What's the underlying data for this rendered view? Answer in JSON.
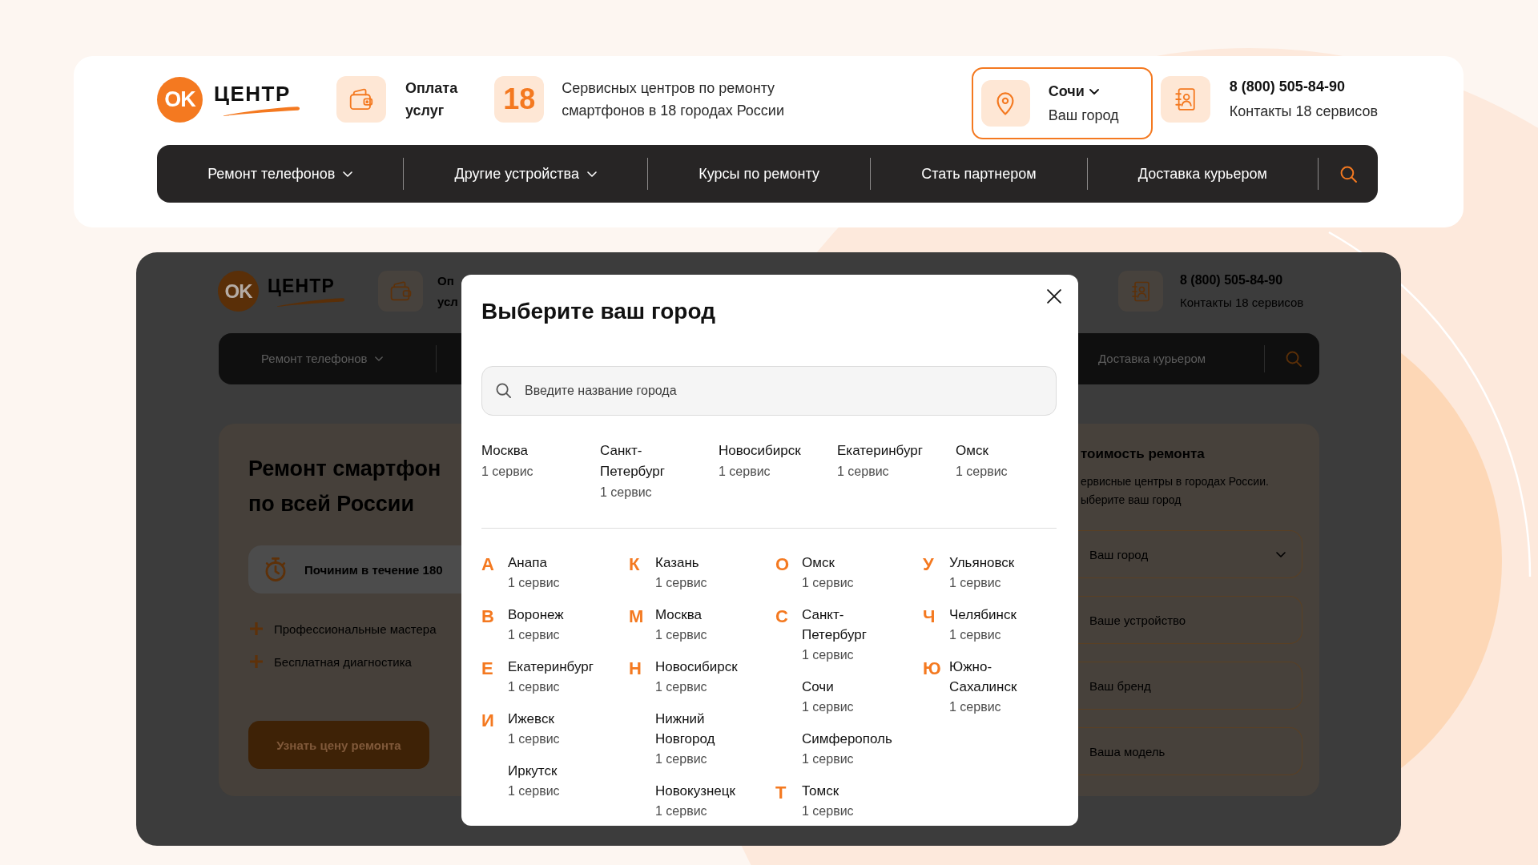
{
  "header": {
    "logo": {
      "mark": "OK",
      "wordmark": "ЦЕНТР"
    },
    "payment_label": "Оплата услуг",
    "city_count": "18",
    "city_count_text": "Сервисных центров по ремонту смартфонов в 18 городах России",
    "city_selector": {
      "value": "Сочи",
      "caption": "Ваш город"
    },
    "contacts": {
      "phone": "8 (800) 505-84-90",
      "caption": "Контакты 18 сервисов"
    }
  },
  "nav": {
    "items": [
      {
        "label": "Ремонт телефонов",
        "kind": "dropdown"
      },
      {
        "label": "Другие устройства",
        "kind": "dropdown"
      },
      {
        "label": "Курсы по ремонту",
        "kind": "link"
      },
      {
        "label": "Стать партнером",
        "kind": "link"
      },
      {
        "label": "Доставка курьером",
        "kind": "link"
      }
    ]
  },
  "preview": {
    "header": {
      "logo": {
        "mark": "OK",
        "wordmark": "ЦЕНТР"
      },
      "payment_label": "Оп усл",
      "contacts": {
        "phone": "8 (800) 505-84-90",
        "caption": "Контакты 18 сервисов"
      }
    },
    "nav_left": [
      {
        "label": "Ремонт телефонов",
        "kind": "dropdown"
      }
    ],
    "nav_right": [
      {
        "label": "Доставка курьером",
        "kind": "link"
      }
    ],
    "hero": {
      "title_lines": [
        "Ремонт смартфон",
        "по всей России"
      ],
      "badge": "Починим в течение 180",
      "features": [
        "Профессиональные мастера",
        "Бесплатная диагностика"
      ],
      "button": "Узнать цену ремонта"
    },
    "price_form": {
      "title": "тоимость ремонта",
      "text_lines": [
        "ервисные центры в городах России.",
        "ыберите ваш город"
      ],
      "fields": [
        {
          "placeholder": "Ваш город",
          "kind": "select"
        },
        {
          "placeholder": "Ваше устройство",
          "kind": "input"
        },
        {
          "placeholder": "Ваш бренд",
          "kind": "input"
        },
        {
          "placeholder": "Ваша модель",
          "kind": "input"
        }
      ]
    }
  },
  "city_modal": {
    "title": "Выберите ваш город",
    "search": {
      "placeholder": "Введите название города"
    },
    "popular": [
      {
        "name": "Москва",
        "count": "1 сервис"
      },
      {
        "name": "Санкт-Петербург",
        "count": "1 сервис"
      },
      {
        "name": "Новосибирск",
        "count": "1 сервис"
      },
      {
        "name": "Екатеринбург",
        "count": "1 сервис"
      },
      {
        "name": "Омск",
        "count": "1 сервис"
      }
    ],
    "columns": [
      [
        {
          "letter": "А",
          "cities": [
            {
              "name": "Анапа",
              "count": "1 сервис"
            }
          ]
        },
        {
          "letter": "В",
          "cities": [
            {
              "name": "Воронеж",
              "count": "1 сервис"
            }
          ]
        },
        {
          "letter": "Е",
          "cities": [
            {
              "name": "Екатеринбург",
              "count": "1 сервис"
            }
          ]
        },
        {
          "letter": "И",
          "cities": [
            {
              "name": "Ижевск",
              "count": "1 сервис"
            },
            {
              "name": "Иркутск",
              "count": "1 сервис"
            }
          ]
        }
      ],
      [
        {
          "letter": "К",
          "cities": [
            {
              "name": "Казань",
              "count": "1 сервис"
            }
          ]
        },
        {
          "letter": "М",
          "cities": [
            {
              "name": "Москва",
              "count": "1 сервис"
            }
          ]
        },
        {
          "letter": "Н",
          "cities": [
            {
              "name": "Новосибирск",
              "count": "1 сервис"
            },
            {
              "name": "Нижний Новгород",
              "count": "1 сервис"
            },
            {
              "name": "Новокузнецк",
              "count": "1 сервис"
            }
          ]
        }
      ],
      [
        {
          "letter": "О",
          "cities": [
            {
              "name": "Омск",
              "count": "1 сервис"
            }
          ]
        },
        {
          "letter": "С",
          "cities": [
            {
              "name": "Санкт-Петербург",
              "count": "1 сервис"
            },
            {
              "name": "Сочи",
              "count": "1 сервис"
            },
            {
              "name": "Симферополь",
              "count": "1 сервис"
            }
          ]
        },
        {
          "letter": "Т",
          "cities": [
            {
              "name": "Томск",
              "count": "1 сервис"
            }
          ]
        }
      ],
      [
        {
          "letter": "У",
          "cities": [
            {
              "name": "Ульяновск",
              "count": "1 сервис"
            }
          ]
        },
        {
          "letter": "Ч",
          "cities": [
            {
              "name": "Челябинск",
              "count": "1 сервис"
            }
          ]
        },
        {
          "letter": "Ю",
          "cities": [
            {
              "name": "Южно-Сахалинск",
              "count": "1 сервис"
            }
          ]
        }
      ]
    ]
  }
}
